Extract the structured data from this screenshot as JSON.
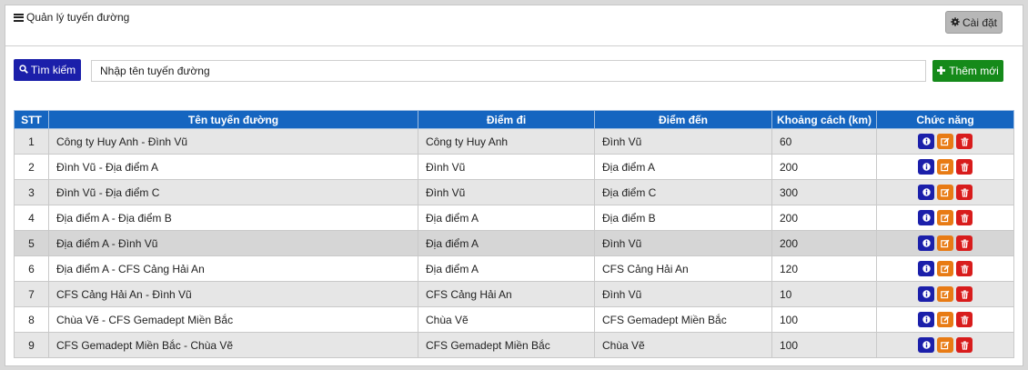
{
  "header": {
    "title": "Quản lý tuyến đường",
    "settings_label": "Cài đặt"
  },
  "toolbar": {
    "search_label": "Tìm kiếm",
    "search_placeholder": "Nhập tên tuyến đường",
    "add_label": "Thêm mới"
  },
  "table": {
    "columns": [
      "STT",
      "Tên tuyến đường",
      "Điểm đi",
      "Điểm đến",
      "Khoảng cách (km)",
      "Chức năng"
    ],
    "rows": [
      {
        "stt": "1",
        "name": "Công ty Huy Anh - Đình Vũ",
        "from": "Công ty Huy Anh",
        "to": "Đình Vũ",
        "distance": "60"
      },
      {
        "stt": "2",
        "name": "Đình Vũ - Địa điểm A",
        "from": "Đình Vũ",
        "to": "Địa điểm A",
        "distance": "200"
      },
      {
        "stt": "3",
        "name": "Đình Vũ - Địa điểm C",
        "from": "Đình Vũ",
        "to": "Địa điểm C",
        "distance": "300"
      },
      {
        "stt": "4",
        "name": "Địa điểm A - Địa điểm B",
        "from": "Địa điểm A",
        "to": "Địa điểm B",
        "distance": "200"
      },
      {
        "stt": "5",
        "name": "Địa điểm A - Đình Vũ",
        "from": "Địa điểm A",
        "to": "Đình Vũ",
        "distance": "200"
      },
      {
        "stt": "6",
        "name": "Địa điểm A - CFS Cảng Hải An",
        "from": "Địa điểm A",
        "to": "CFS Cảng Hải An",
        "distance": "120"
      },
      {
        "stt": "7",
        "name": "CFS Cảng Hải An - Đình Vũ",
        "from": "CFS Cảng Hải An",
        "to": "Đình Vũ",
        "distance": "10"
      },
      {
        "stt": "8",
        "name": "Chùa Vẽ - CFS Gemadept Miền Bắc",
        "from": "Chùa Vẽ",
        "to": "CFS Gemadept Miền Bắc",
        "distance": "100"
      },
      {
        "stt": "9",
        "name": "CFS Gemadept Miền Bắc - Chùa Vẽ",
        "from": "CFS Gemadept Miền Bắc",
        "to": "Chùa Vẽ",
        "distance": "100"
      }
    ],
    "highlighted_row": 5,
    "row_actions": [
      "info-icon",
      "edit-icon",
      "trash-icon"
    ]
  },
  "colors": {
    "header_blue": "#1565c0",
    "primary": "#1b1faa",
    "success": "#158a1a",
    "warning": "#e87b14",
    "danger": "#d81c1c"
  }
}
